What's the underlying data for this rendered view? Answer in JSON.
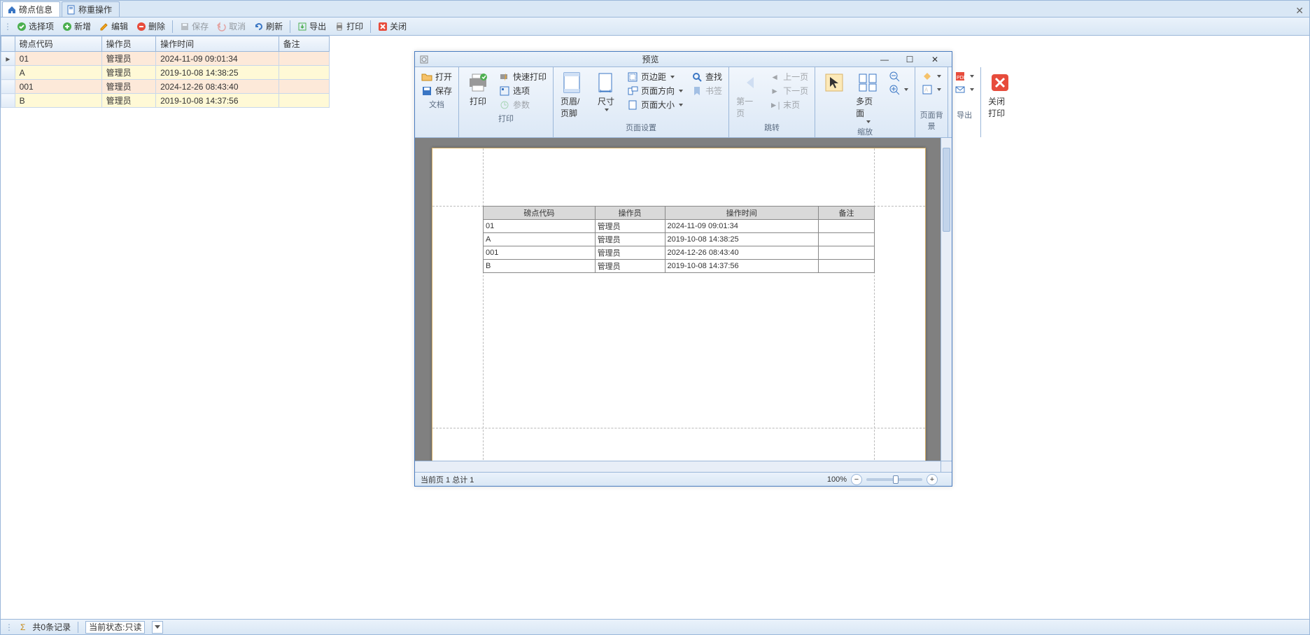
{
  "tabs": [
    {
      "label": "磅点信息",
      "active": true,
      "icon": "home"
    },
    {
      "label": "称重操作",
      "active": false,
      "icon": "doc"
    }
  ],
  "toolbar": [
    {
      "key": "select",
      "label": "选择项",
      "icon": "check-green",
      "enabled": true
    },
    {
      "key": "new",
      "label": "新增",
      "icon": "plus-green",
      "enabled": true
    },
    {
      "key": "edit",
      "label": "编辑",
      "icon": "pencil",
      "enabled": true
    },
    {
      "key": "delete",
      "label": "删除",
      "icon": "minus-red",
      "enabled": true
    },
    {
      "sep": true
    },
    {
      "key": "save",
      "label": "保存",
      "icon": "disk",
      "enabled": false
    },
    {
      "key": "cancel",
      "label": "取消",
      "icon": "undo-red",
      "enabled": false
    },
    {
      "key": "refresh",
      "label": "刷新",
      "icon": "refresh-blue",
      "enabled": true
    },
    {
      "sep": true
    },
    {
      "key": "export",
      "label": "导出",
      "icon": "export",
      "enabled": true
    },
    {
      "key": "print",
      "label": "打印",
      "icon": "printer",
      "enabled": true
    },
    {
      "sep": true
    },
    {
      "key": "close",
      "label": "关闭",
      "icon": "x-red",
      "enabled": true
    }
  ],
  "grid": {
    "columns": [
      "磅点代码",
      "操作员",
      "操作时间",
      "备注"
    ],
    "rows": [
      {
        "code": "01",
        "op": "管理员",
        "time": "2024-11-09 09:01:34",
        "note": "",
        "mark": true
      },
      {
        "code": "A",
        "op": "管理员",
        "time": "2019-10-08 14:38:25",
        "note": ""
      },
      {
        "code": "001",
        "op": "管理员",
        "time": "2024-12-26 08:43:40",
        "note": ""
      },
      {
        "code": "B",
        "op": "管理员",
        "time": "2019-10-08 14:37:56",
        "note": ""
      }
    ]
  },
  "status": {
    "records": "共0条记录",
    "state": "当前状态:只读"
  },
  "preview": {
    "title": "预览",
    "groups": {
      "doc": {
        "label": "文档",
        "open": "打开",
        "save": "保存"
      },
      "print": {
        "label": "打印",
        "print": "打印",
        "quick": "快速打印",
        "options": "选项",
        "params": "参数"
      },
      "page_setup": {
        "label": "页面设置",
        "header_footer": "页眉/页脚",
        "size": "尺寸",
        "margins": "页边距",
        "orientation": "页面方向",
        "pagesize": "页面大小",
        "find": "查找",
        "bookmark": "书签"
      },
      "jump": {
        "label": "跳转",
        "first": "第一页",
        "prev": "上一页",
        "next": "下一页",
        "last": "末页"
      },
      "zoom": {
        "label": "缩放",
        "pointer": "指针",
        "multi": "多页面",
        "zoomout": "缩小",
        "zoomin": "放大"
      },
      "bg": {
        "label": "页面背景"
      },
      "export": {
        "label": "导出"
      },
      "closeprint": {
        "label": "关闭打印",
        "btn": "关闭打印"
      }
    },
    "table": {
      "headers": [
        "磅点代码",
        "操作员",
        "操作时间",
        "备注"
      ],
      "rows": [
        [
          "01",
          "管理员",
          "2024-11-09 09:01:34",
          ""
        ],
        [
          "A",
          "管理员",
          "2019-10-08 14:38:25",
          ""
        ],
        [
          "001",
          "管理员",
          "2024-12-26 08:43:40",
          ""
        ],
        [
          "B",
          "管理员",
          "2019-10-08 14:37:56",
          ""
        ]
      ]
    },
    "status": {
      "page": "当前页 1 总计 1",
      "zoom": "100%"
    }
  }
}
